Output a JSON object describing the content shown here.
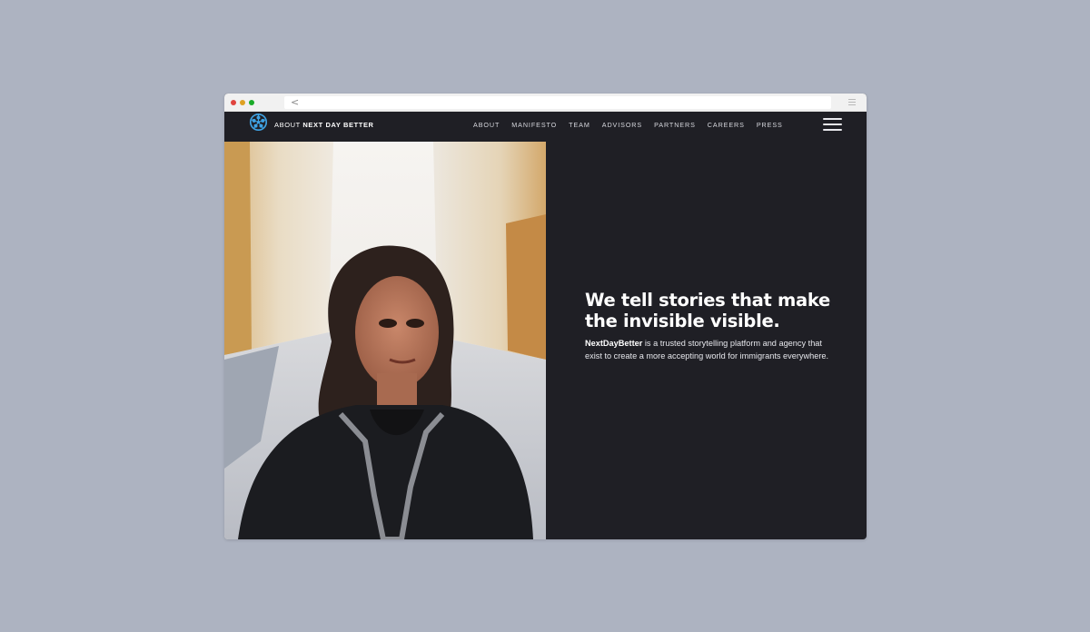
{
  "browser": {
    "back_glyph": "<",
    "icons": {
      "back": "chevron-left-icon",
      "menu": "menu-icon"
    },
    "traffic_lights": {
      "red": "#e0443e",
      "yellow": "#dea123",
      "green": "#1aab29"
    }
  },
  "navbar": {
    "logo_icon": "film-reel-icon",
    "brand_prefix": "ABOUT",
    "brand_name": "NEXT DAY BETTER",
    "items": [
      {
        "label": "ABOUT"
      },
      {
        "label": "MANIFESTO"
      },
      {
        "label": "TEAM"
      },
      {
        "label": "ADVISORS"
      },
      {
        "label": "PARTNERS"
      },
      {
        "label": "CAREERS"
      },
      {
        "label": "PRESS"
      }
    ],
    "menu_icon": "hamburger-menu-icon"
  },
  "hero": {
    "image": "woman-on-city-street-photo",
    "headline": "We tell stories that make the invisible visible.",
    "brand_inline": "NextDayBetter",
    "description": " is a trusted storytelling platform and agency that exist to create a more accepting world for immigrants everywhere."
  },
  "colors": {
    "background": "#adb3c1",
    "panel": "#1f1f25",
    "logo_accent": "#3fa3e4"
  }
}
